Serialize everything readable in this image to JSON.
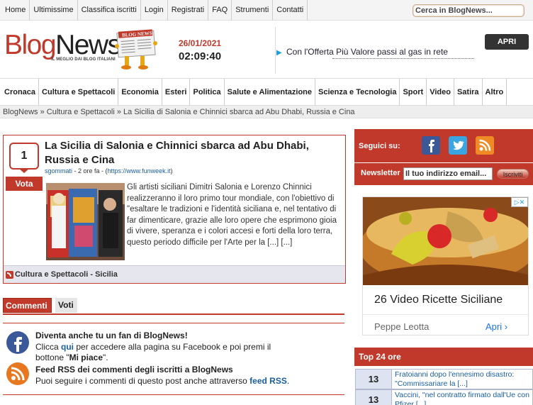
{
  "topnav": {
    "items": [
      "Home",
      "Ultimissime",
      "Classifica iscritti",
      "Login",
      "Registrati",
      "FAQ",
      "Strumenti",
      "Contatti"
    ],
    "search_placeholder": "Cerca in BlogNews..."
  },
  "header": {
    "logo_blog": "Blog",
    "logo_news": "News",
    "logo_tagline": "IL MEGLIO DAI BLOG ITALIANI",
    "logo_paper_text": "BLOG NEWS",
    "date": "26/01/2021",
    "time": "02:09:40",
    "ad_text": "Con l'Offerta Più Valore passi al gas in rete",
    "ad_button": "APRI"
  },
  "catnav": {
    "items": [
      "Cronaca",
      "Cultura e Spettacoli",
      "Economia",
      "Esteri",
      "Politica",
      "Salute e Alimentazione",
      "Scienza e Tecnologia",
      "Sport",
      "Video",
      "Satira",
      "Altro"
    ]
  },
  "breadcrumb": {
    "items": [
      "BlogNews",
      "Cultura e Spettacoli",
      "La Sicilia di Salonia e Chinnici sbarca ad Abu Dhabi, Russia e Cina"
    ],
    "sep": "»"
  },
  "article": {
    "votes": "1",
    "vote_label": "Vota",
    "title": "La Sicilia di Salonia e Chinnici sbarca ad Abu Dhabi, Russia e Cina",
    "author": "sgommati",
    "time_ago": "- 2 ore fa - (",
    "source": "https://www.funweek.it",
    "source_close": ")",
    "body": "Gli artisti siciliani Dimitri Salonia e Lorenzo Chinnici realizzeranno il loro primo tour mondiale, con l'obiettivo di \"esaltare le tradizioni e l'identità siciliana e, nel tentativo di far dimenticare, grazie alle loro opere che esprimono gioia di vivere, speranza e i colori accesi e forti della loro terra, questo periodo difficile per l'Arte per la [...] [...]",
    "category": "Cultura e Spettacoli - Sicilia"
  },
  "tabs": {
    "comments": "Commenti",
    "votes": "Voti"
  },
  "fan": {
    "fb_head": "Diventa anche tu un fan di BlogNews!",
    "fb_line1a": "Clicca ",
    "fb_link": "qui",
    "fb_line1b": " per accedere alla pagina su Facebook e poi premi il",
    "fb_line2a": "bottone \"",
    "fb_like": "Mi piace",
    "fb_line2b": "\".",
    "rss_head": "Feed RSS dei commenti degli iscritti a BlogNews",
    "rss_line_a": "Puoi seguire i commenti di questo post anche attraverso ",
    "rss_link": "feed RSS",
    "rss_line_b": "."
  },
  "sidebar": {
    "follow_label": "Seguici su:",
    "newsletter_label": "Newsletter",
    "newsletter_placeholder": "Il tuo indirizzo email...",
    "newsletter_button": "Iscriviti",
    "ad_title": "26 Video Ricette Siciliane",
    "ad_author": "Peppe Leotta",
    "ad_open": "Apri",
    "ad_open_chevron": "›",
    "ad_choices": "▷✕",
    "top24_title": "Top 24 ore",
    "top24": [
      {
        "num": "13",
        "title": "Fratoianni dopo l'ennesimo disastro: \"Commissariare la [...]"
      },
      {
        "num": "13",
        "title": "Vaccini, \"nel contratto firmato dall'Ue con Pfizer [...]"
      }
    ]
  },
  "colors": {
    "brand_red": "#c0392b",
    "link_blue": "#1a5fa0"
  },
  "icons": [
    "search-icon",
    "facebook-icon",
    "twitter-icon",
    "rss-icon",
    "ad-arrow-icon"
  ]
}
